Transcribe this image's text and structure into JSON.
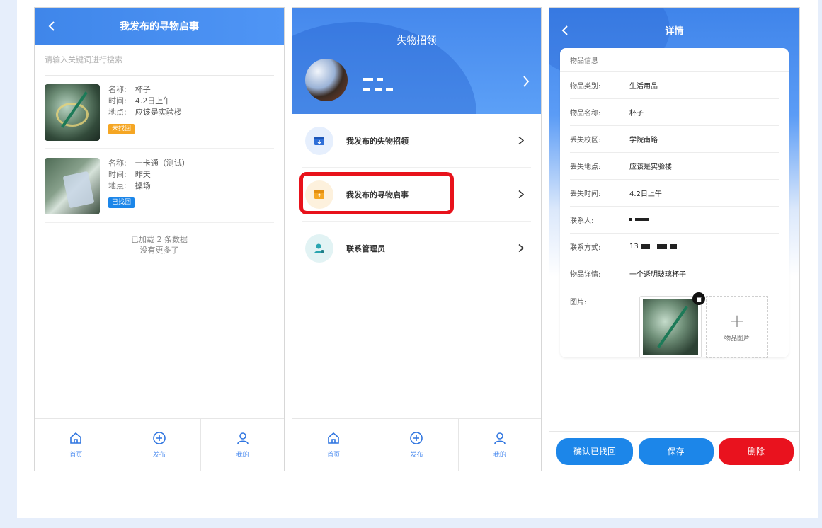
{
  "colors": {
    "primary": "#3f86ea",
    "badge_orange": "#f5a623",
    "badge_blue": "#1c86e9",
    "danger": "#e9121e",
    "highlight": "#e8121b"
  },
  "screen1": {
    "title": "我发布的寻物启事",
    "search_placeholder": "请输入关键词进行搜索",
    "items": [
      {
        "name_label": "名称:",
        "name": "杯子",
        "time_label": "时间:",
        "time": "4.2日上午",
        "place_label": "地点:",
        "place": "应该是实验楼",
        "status": "未找回",
        "status_color": "#f5a623",
        "image_icon": "cup-photo"
      },
      {
        "name_label": "名称:",
        "name": "一卡通（测试）",
        "time_label": "时间:",
        "time": "昨天",
        "place_label": "地点:",
        "place": "操场",
        "status": "已找回",
        "status_color": "#1c86e9",
        "image_icon": "card-photo"
      }
    ],
    "loaded_text": "已加载 2 条数据",
    "no_more_text": "没有更多了",
    "tabs": [
      {
        "label": "首页",
        "icon": "home-icon"
      },
      {
        "label": "发布",
        "icon": "plus-circle-icon"
      },
      {
        "label": "我的",
        "icon": "user-icon"
      }
    ]
  },
  "screen2": {
    "title": "失物招领",
    "menu": [
      {
        "label": "我发布的失物招领",
        "icon": "inbox-icon",
        "icon_bg": "#e6effd",
        "icon_color": "#2f6fd8"
      },
      {
        "label": "我发布的寻物启事",
        "icon": "box-icon",
        "icon_bg": "#fdf1dd",
        "icon_color": "#f5a623"
      },
      {
        "label": "联系管理员",
        "icon": "admin-icon",
        "icon_bg": "#e2f3f4",
        "icon_color": "#2aa5b0"
      }
    ],
    "tabs": [
      {
        "label": "首页",
        "icon": "home-icon"
      },
      {
        "label": "发布",
        "icon": "plus-circle-icon"
      },
      {
        "label": "我的",
        "icon": "user-icon"
      }
    ]
  },
  "screen3": {
    "title": "详情",
    "section_title": "物品信息",
    "fields": [
      {
        "label": "物品类别:",
        "value": "生活用品"
      },
      {
        "label": "物品名称:",
        "value": "杯子"
      },
      {
        "label": "丢失校区:",
        "value": "学院南路"
      },
      {
        "label": "丢失地点:",
        "value": "应该是实验楼"
      },
      {
        "label": "丢失时间:",
        "value": "4.2日上午"
      },
      {
        "label": "联系人:",
        "value": ""
      },
      {
        "label": "联系方式:",
        "value": "13"
      },
      {
        "label": "物品详情:",
        "value": "一个透明玻璃杯子"
      }
    ],
    "image_label": "图片:",
    "add_image_label": "物品图片",
    "buttons": {
      "confirm": "确认已找回",
      "save": "保存",
      "delete": "删除"
    }
  }
}
